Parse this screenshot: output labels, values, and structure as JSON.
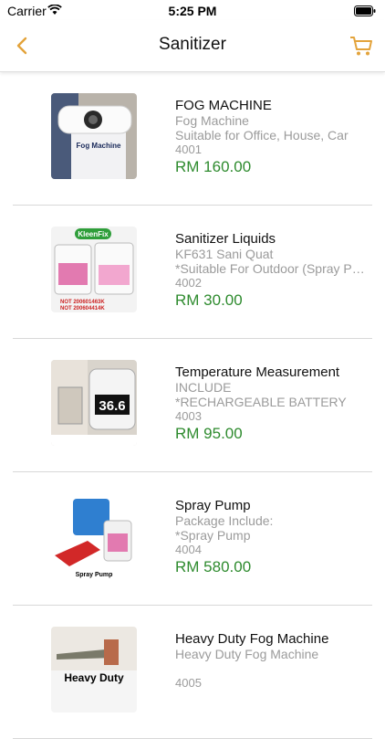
{
  "status_bar": {
    "carrier": "Carrier",
    "time": "5:25 PM"
  },
  "nav": {
    "title": "Sanitizer"
  },
  "colors": {
    "accent": "#e3a33b",
    "price": "#2e8b2e",
    "muted": "#9b9b9b"
  },
  "products": [
    {
      "name": "FOG MACHINE",
      "subtitle": "Fog Machine",
      "description": "Suitable for Office, House, Car",
      "code": "4001",
      "price": "RM 160.00",
      "image_label": "Fog Machine"
    },
    {
      "name": "Sanitizer Liquids",
      "subtitle": "KF631 Sani Quat",
      "description": "*Suitable For Outdoor (Spray Pump)",
      "code": "4002",
      "price": "RM 30.00",
      "image_label": "KleenFix"
    },
    {
      "name": "Temperature Measurement",
      "subtitle": "INCLUDE",
      "description": "*RECHARGEABLE BATTERY",
      "code": "4003",
      "price": "RM 95.00",
      "image_label": "36.6"
    },
    {
      "name": "Spray Pump",
      "subtitle": "Package Include:",
      "description": "*Spray Pump",
      "code": "4004",
      "price": "RM 580.00",
      "image_label": "Spray Pump"
    },
    {
      "name": "Heavy Duty Fog Machine",
      "subtitle": "Heavy Duty Fog Machine",
      "description": "",
      "code": "4005",
      "price": "",
      "image_label": "Heavy Duty"
    }
  ]
}
